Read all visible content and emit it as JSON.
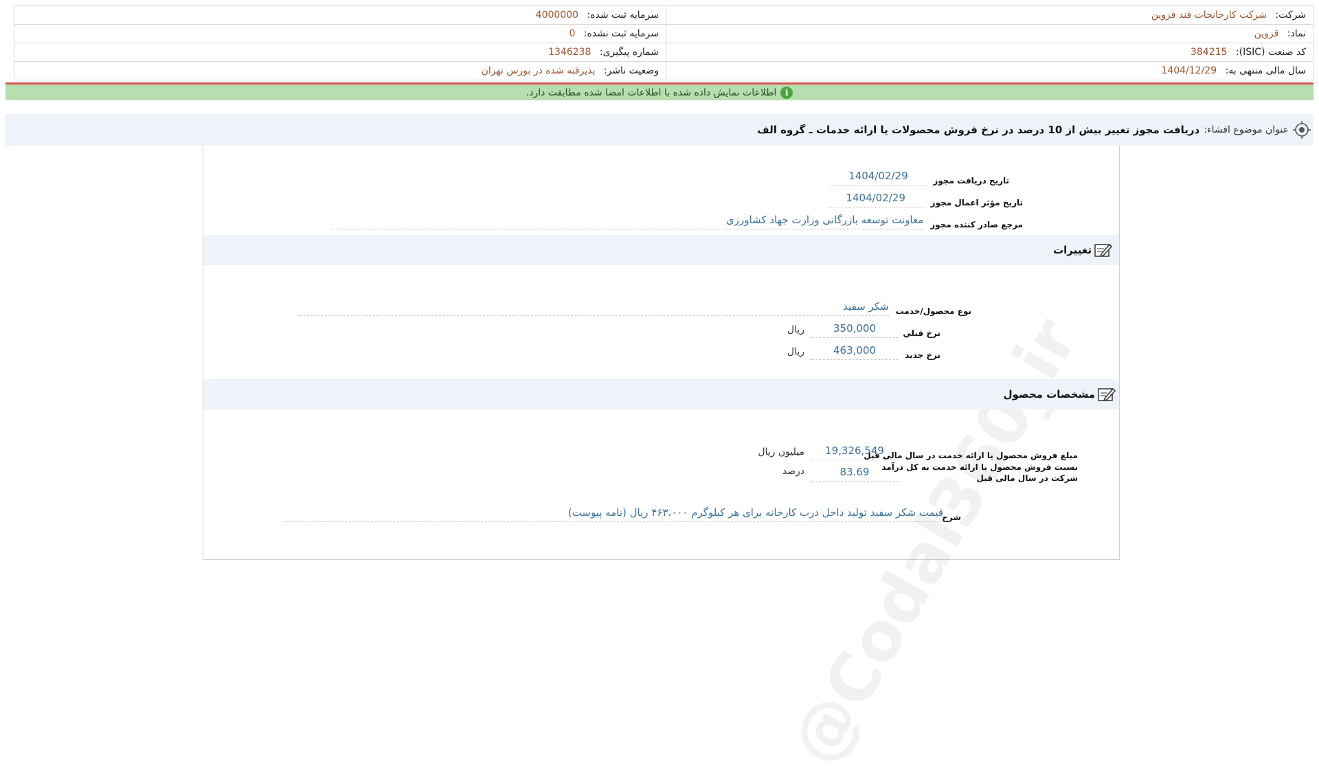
{
  "header": {
    "company_label": "شرکت:",
    "company_value": "شرکت کارخانجات قند قزوين",
    "symbol_label": "نماد:",
    "symbol_value": "قزوين",
    "isic_label": "کد صنعت (ISIC):",
    "isic_value": "384215",
    "fiscal_label": "سال مالی منتهی به:",
    "fiscal_value": "1404/12/29",
    "capital_registered_label": "سرمایه ثبت شده:",
    "capital_registered_value": "4000000",
    "capital_unregistered_label": "سرمایه ثبت نشده:",
    "capital_unregistered_value": "0",
    "tracking_label": "شماره پیگیری:",
    "tracking_value": "1346238",
    "status_label": "وضعیت ناشر:",
    "status_value": "پذیرفته شده در بورس تهران"
  },
  "notice": {
    "text": "اطلاعات نمایش داده شده با اطلاعات امضا شده مطابقت دارد.",
    "icon": "info-icon",
    "color": "#b7deae"
  },
  "subject": {
    "label": "عنوان موضوع افشاء:",
    "text": "دریافت مجوز تغییر بیش از 10 درصد در نرخ فروش محصولات یا ارائه خدمات ـ گروه الف"
  },
  "permit": {
    "receive_date_label": "تاريخ دريافت مجوز",
    "receive_date_value": "1404/02/29",
    "effective_date_label": "تاريخ مؤثر اعمال مجوز",
    "effective_date_value": "1404/02/29",
    "issuer_label": "مرجع صادر کننده مجوز",
    "issuer_value": "معاونت توسعه بازرگانی وزارت جهاد کشاورزی"
  },
  "changes": {
    "title": "تغييرات",
    "product_label": "نوع محصول/خدمت",
    "product_value": "شکر سفيد",
    "prev_rate_label": "نرخ قبلي",
    "prev_rate_value": "350,000",
    "prev_rate_unit": "ريال",
    "new_rate_label": "نرخ جديد",
    "new_rate_value": "463,000",
    "new_rate_unit": "ريال"
  },
  "product_specs": {
    "title": "مشخصات محصول",
    "sales_label": "مبلغ فروش محصول يا ارائه خدمت در سال مالی قبل",
    "sales_value": "19,326,549",
    "sales_unit": "ميليون ريال",
    "ratio_label_line1": "نسبت فروش محصول يا ارائه خدمت به کل درآمد",
    "ratio_label_line2": "شرکت در سال مالی قبل",
    "ratio_value": "83.69",
    "ratio_unit": "درصد",
    "desc_label": "شرح",
    "desc_value": "قیمت شکر سفید تولید داخل درب کارخانه برای هر کیلوگرم ۴۶۳،۰۰۰ ریال (نامه پیوست)"
  },
  "watermark": {
    "text": "@Codal360_ir"
  }
}
